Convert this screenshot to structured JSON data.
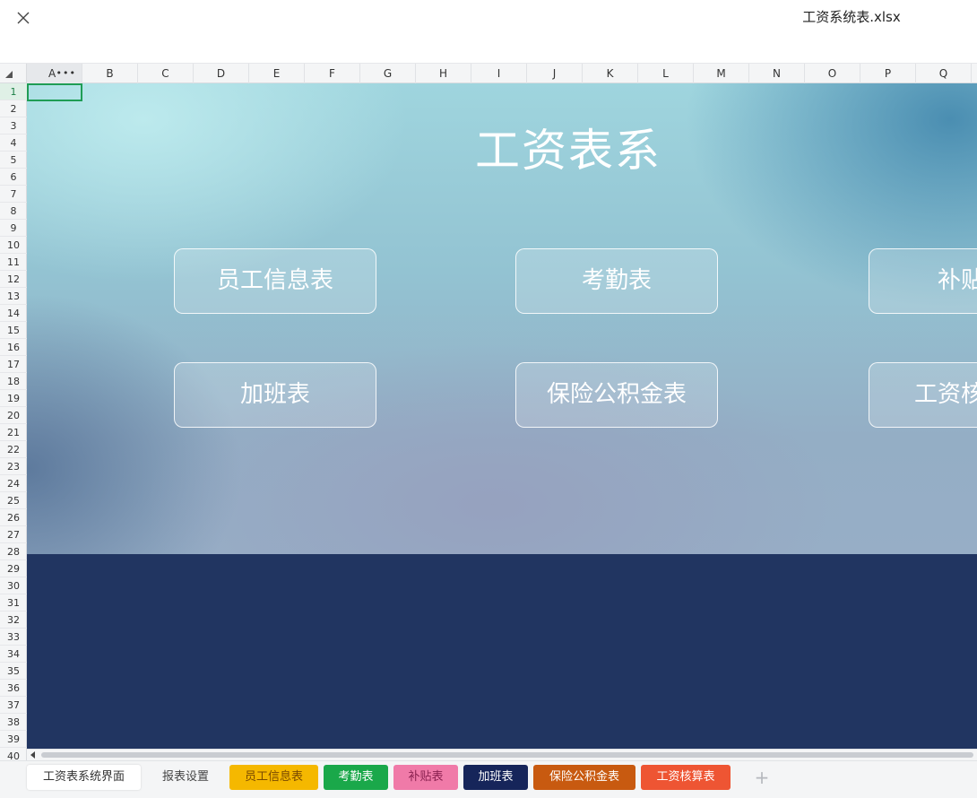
{
  "window": {
    "file_name": "工资系统表.xlsx",
    "close_icon": "close-icon"
  },
  "sheet": {
    "columns": [
      "A",
      "B",
      "C",
      "D",
      "E",
      "F",
      "G",
      "H",
      "I",
      "J",
      "K",
      "L",
      "M",
      "N",
      "O",
      "P",
      "Q"
    ],
    "rows": [
      "1",
      "2",
      "3",
      "4",
      "5",
      "6",
      "7",
      "8",
      "9",
      "10",
      "11",
      "12",
      "13",
      "14",
      "15",
      "16",
      "17",
      "18",
      "19",
      "20",
      "21",
      "22",
      "23",
      "24",
      "25",
      "26",
      "27",
      "28",
      "29",
      "30",
      "31",
      "32",
      "33",
      "34",
      "35",
      "36",
      "37",
      "38",
      "39",
      "40"
    ],
    "selected_cell": "A1",
    "column_menu_icon": "more-dots-icon"
  },
  "dashboard": {
    "title": "工资表系",
    "buttons": [
      {
        "label": "员工信息表"
      },
      {
        "label": "考勤表"
      },
      {
        "label": "补贴"
      },
      {
        "label": "加班表"
      },
      {
        "label": "保险公积金表"
      },
      {
        "label": "工资核"
      }
    ],
    "colors": {
      "dark_band": "#213561",
      "hero_light": "#9fd5de",
      "hero_dark": "#3c82aa"
    }
  },
  "tabs": [
    {
      "label": "工资表系统界面",
      "color": "#ffffff",
      "text_color": "#333333",
      "active": true
    },
    {
      "label": "报表设置",
      "color": "#f4f5f6",
      "text_color": "#444444",
      "active": false
    },
    {
      "label": "员工信息表",
      "color": "#f5b800",
      "text_color": "#7a4a00",
      "active": false
    },
    {
      "label": "考勤表",
      "color": "#1aa84a",
      "text_color": "#ffffff",
      "active": false
    },
    {
      "label": "补贴表",
      "color": "#f07aa8",
      "text_color": "#8a2150",
      "active": false
    },
    {
      "label": "加班表",
      "color": "#16255a",
      "text_color": "#ffffff",
      "active": false
    },
    {
      "label": "保险公积金表",
      "color": "#c85a10",
      "text_color": "#ffffff",
      "active": false
    },
    {
      "label": "工资核算表",
      "color": "#ee5533",
      "text_color": "#ffffff",
      "active": false
    }
  ],
  "tab_add_icon": "plus-icon"
}
